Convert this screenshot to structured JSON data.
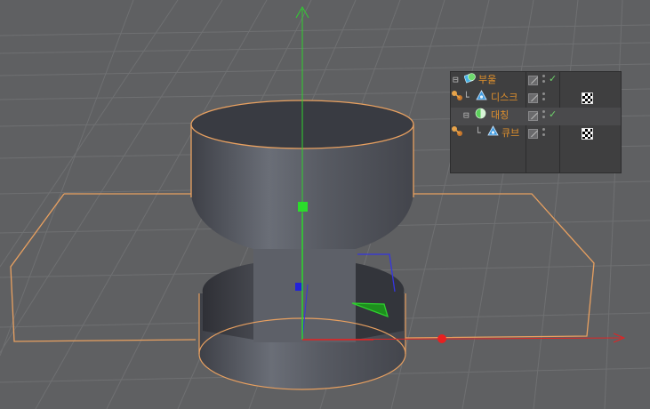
{
  "viewport": {
    "colors": {
      "background": "#5f6062",
      "grid_line": "#6e6f71",
      "selection_outline": "#e8a060",
      "axis_y": "#2fd12f",
      "axis_x": "#e02424",
      "axis_z": "#3535e0",
      "cylinder_side": "#5b5e66",
      "cylinder_top": "#3a3c43"
    }
  },
  "object_manager": {
    "objects": [
      {
        "name": "부울",
        "icon": "boole-icon",
        "tree": "⊟",
        "check": "✓"
      },
      {
        "name": "디스크",
        "icon": "disc-icon",
        "tree": "└",
        "check": ""
      },
      {
        "name": "대칭",
        "icon": "symmetry-icon",
        "tree": "⊟",
        "check": "✓"
      },
      {
        "name": "큐브",
        "icon": "cube-icon",
        "tree": "└",
        "check": ""
      }
    ]
  }
}
